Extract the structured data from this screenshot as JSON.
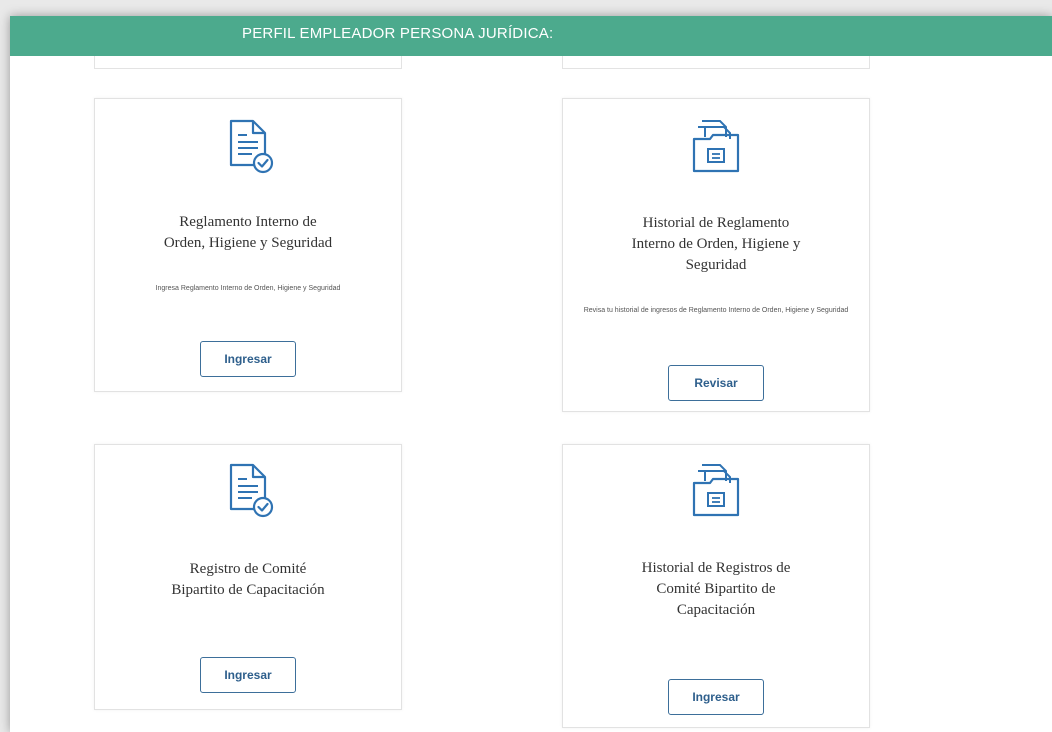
{
  "header": {
    "title": "PERFIL EMPLEADOR PERSONA JURÍDICA:"
  },
  "colors": {
    "header": "#4caa8d",
    "icon": "#2f73b3",
    "button_border": "#3d6f9a",
    "button_text": "#2e5f8c"
  },
  "cards": [
    {
      "icon": "document-check-icon",
      "title": "Reglamento Interno de\nOrden, Higiene y Seguridad",
      "description": "Ingresa Reglamento Interno de Orden, Higiene y Seguridad",
      "button": "Ingresar"
    },
    {
      "icon": "folder-archive-icon",
      "title": "Historial de Reglamento\nInterno de Orden, Higiene y\nSeguridad",
      "description": "Revisa tu historial de ingresos de Reglamento Interno de Orden, Higiene y Seguridad",
      "button": "Revisar"
    },
    {
      "icon": "document-check-icon",
      "title": "Registro de Comité\nBipartito de Capacitación",
      "description": "",
      "button": "Ingresar"
    },
    {
      "icon": "folder-archive-icon",
      "title": "Historial de Registros de\nComité Bipartito de\nCapacitación",
      "description": "",
      "button": "Ingresar"
    }
  ]
}
